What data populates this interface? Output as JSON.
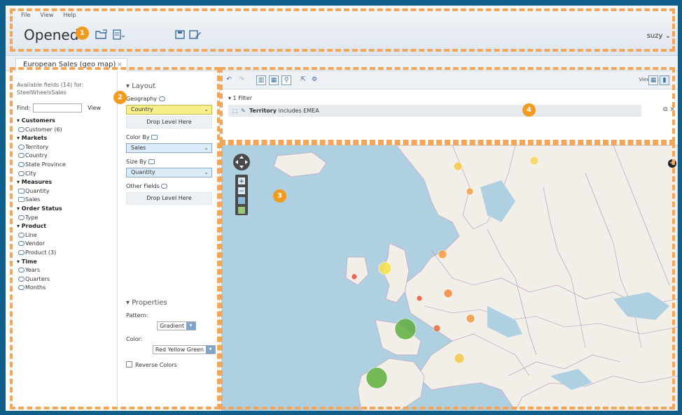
{
  "menu": [
    "File",
    "View",
    "Help"
  ],
  "header": {
    "title": "Opened",
    "user": "suzy ⌄"
  },
  "tab": {
    "label": "European Sales (geo map)",
    "close": "×"
  },
  "fields": {
    "available": "Available fields (14) for: SteelWheelsSales",
    "find_label": "Find:",
    "find_value": "",
    "view_label": "View",
    "tree": [
      {
        "type": "grp",
        "label": "▾ Customers"
      },
      {
        "type": "itm",
        "label": "Customer (6)"
      },
      {
        "type": "grp",
        "label": "▾ Markets"
      },
      {
        "type": "itm",
        "label": "Territory"
      },
      {
        "type": "itm",
        "label": "Country"
      },
      {
        "type": "itm",
        "label": "State Province"
      },
      {
        "type": "itm",
        "label": "City"
      },
      {
        "type": "grp",
        "label": "▾ Measures"
      },
      {
        "type": "meas",
        "label": "Quantity"
      },
      {
        "type": "meas",
        "label": "Sales"
      },
      {
        "type": "grp",
        "label": "▾ Order Status"
      },
      {
        "type": "itm",
        "label": "Type"
      },
      {
        "type": "grp",
        "label": "▾ Product"
      },
      {
        "type": "itm",
        "label": "Line"
      },
      {
        "type": "itm",
        "label": "Vendor"
      },
      {
        "type": "itm",
        "label": "Product (3)"
      },
      {
        "type": "grp",
        "label": "▾ Time"
      },
      {
        "type": "itm",
        "label": "Years"
      },
      {
        "type": "itm",
        "label": "Quarters"
      },
      {
        "type": "itm",
        "label": "Months"
      }
    ]
  },
  "layout": {
    "section": "▾ Layout",
    "geography_label": "Geography",
    "geography_value": "Country",
    "drop_here": "Drop Level Here",
    "color_by_label": "Color By",
    "color_by_value": "Sales",
    "size_by_label": "Size By",
    "size_by_value": "Quantity",
    "other_fields_label": "Other Fields",
    "properties": "▾ Properties",
    "pattern_label": "Pattern:",
    "pattern_value": "Gradient",
    "color_label": "Color:",
    "color_value": "Red Yellow Green",
    "reverse_label": "Reverse Colors"
  },
  "report": {
    "view_as": "View As:",
    "filter_count": "▾ 1 Filter",
    "filter_field": "Territory",
    "filter_text": " includes EMEA"
  },
  "callouts": [
    "1",
    "2",
    "3",
    "4"
  ],
  "colors": {
    "accent": "#f29b1e",
    "frame": "#0f5f8a",
    "sea": "#aed0e0",
    "land": "#f2efe9"
  },
  "map_bubbles": [
    {
      "color": "#f6c84a"
    },
    {
      "color": "#f6a040"
    },
    {
      "color": "#f7d35a"
    },
    {
      "color": "#f7e04a"
    },
    {
      "color": "#e74c3c"
    },
    {
      "color": "#f39c3c"
    },
    {
      "color": "#f08a3a"
    },
    {
      "color": "#e55a3a"
    },
    {
      "color": "#f09a3a"
    },
    {
      "color": "#5fae3e"
    },
    {
      "color": "#e86a3a"
    },
    {
      "color": "#f6c84a"
    },
    {
      "color": "#5fae3e"
    }
  ]
}
